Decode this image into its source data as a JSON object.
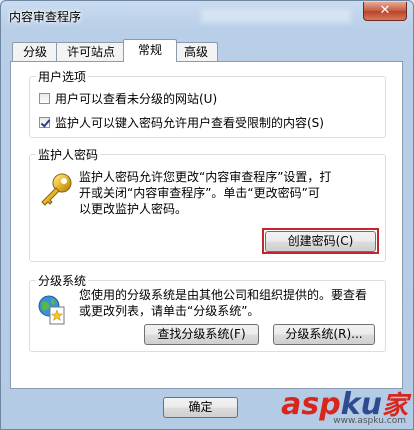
{
  "window": {
    "title": "内容审查程序",
    "close_glyph": "✕"
  },
  "tabs": [
    {
      "label": "分级",
      "active": false
    },
    {
      "label": "许可站点",
      "active": false
    },
    {
      "label": "常规",
      "active": true
    },
    {
      "label": "高级",
      "active": false
    }
  ],
  "user_options": {
    "legend": "用户选项",
    "option1": {
      "label": "用户可以查看未分级的网站(U)",
      "checked": false
    },
    "option2": {
      "label": "监护人可以键入密码允许用户查看受限制的内容(S)",
      "checked": true
    }
  },
  "supervisor": {
    "legend": "监护人密码",
    "icon": "key-icon",
    "line1": "监护人密码允许您更改“内容审查程序”设置，打",
    "line2": "开或关闭“内容审查程序”。单击“更改密码”可",
    "line3": "以更改监护人密码。",
    "create_button": "创建密码(C)"
  },
  "rating": {
    "legend": "分级系统",
    "icon": "rating-document-icon",
    "line1": "您使用的分级系统是由其他公司和组织提供的。要查看",
    "line2": "或更改列表，请单击“分级系统”。",
    "find_button": "查找分级系统(F)",
    "systems_button": "分级系统(R)..."
  },
  "footer": {
    "ok_button": "确定"
  },
  "watermark": {
    "brand_a": "asp",
    "brand_b": "ku",
    "brand_c": "家",
    "url": "www.aspku.com"
  },
  "colors": {
    "highlight": "#c0272d",
    "accent": "#2f4b8f"
  }
}
